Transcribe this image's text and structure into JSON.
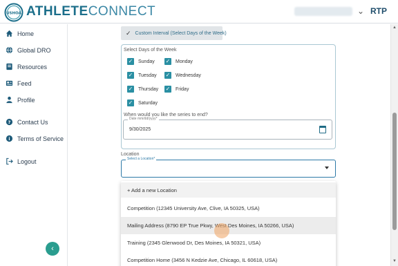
{
  "header": {
    "brand_bold": "ATHLETE",
    "brand_light": "CONNECT",
    "logo_text": "USHOA",
    "org": "RTP",
    "chevron": "⌄"
  },
  "sidebar": {
    "items": [
      {
        "label": "Home",
        "icon": "home-icon"
      },
      {
        "label": "Global DRO",
        "icon": "globe-icon"
      },
      {
        "label": "Resources",
        "icon": "book-icon"
      },
      {
        "label": "Feed",
        "icon": "feed-icon"
      },
      {
        "label": "Profile",
        "icon": "person-icon"
      },
      {
        "label": "Contact Us",
        "icon": "question-icon"
      },
      {
        "label": "Terms of Service",
        "icon": "info-icon"
      },
      {
        "label": "Logout",
        "icon": "logout-icon"
      }
    ],
    "collapse_glyph": "‹"
  },
  "form": {
    "interval_option": "Custom Interval (Select Days of the Week)",
    "days_label": "Select Days of the Week",
    "days": [
      {
        "label": "Sunday",
        "checked": true
      },
      {
        "label": "Monday",
        "checked": true
      },
      {
        "label": "Tuesday",
        "checked": true
      },
      {
        "label": "Wednesday",
        "checked": true
      },
      {
        "label": "Thursday",
        "checked": true
      },
      {
        "label": "Friday",
        "checked": true
      },
      {
        "label": "Saturday",
        "checked": true
      }
    ],
    "end_label": "When would you like the series to end?",
    "date_legend": "Date mm/dd/yyyy*",
    "date_value": "9/30/2025",
    "location_label": "Location",
    "location_legend": "Select a Location*",
    "location_value": ""
  },
  "dropdown": {
    "add_label": "+ Add a new Location",
    "options": [
      "Competition  (12345 University Ave, Clive, IA 50325, USA)",
      "Mailing Address (8790 EP True Pkwy, West Des Moines, IA 50266, USA)",
      "Training (2345 Glenwood Dr, Des Moines, IA 50321, USA)",
      "Competition Home (3456 N Kedzie Ave, Chicago, IL 60618, USA)"
    ],
    "hovered_index": 1
  },
  "colors": {
    "brand": "#1b6e8a",
    "accent": "#2a8fa3",
    "focus": "#2b78a6",
    "collapse_button": "#2a9d8f"
  }
}
